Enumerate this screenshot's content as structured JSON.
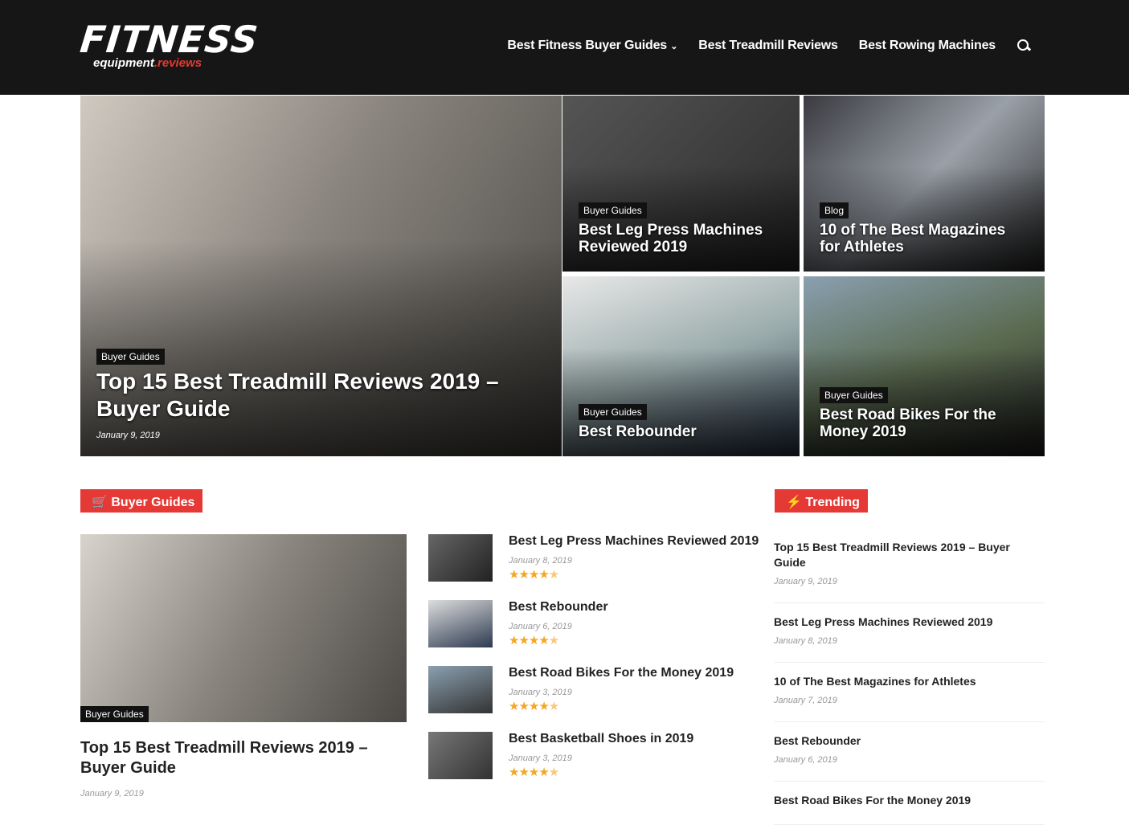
{
  "header": {
    "logo_main": "FITNESS",
    "logo_sub_a": "equipment",
    "logo_sub_b": ".reviews",
    "nav": [
      {
        "label": "Best Fitness Buyer Guides",
        "chevron": true
      },
      {
        "label": "Best Treadmill Reviews"
      },
      {
        "label": "Best Rowing Machines"
      }
    ],
    "search_icon": "search-icon"
  },
  "hero": [
    {
      "category": "Buyer Guides",
      "title": "Top 15 Best Treadmill Reviews 2019 – Buyer Guide",
      "date": "January 9, 2019"
    },
    {
      "category": "Buyer Guides",
      "title": "Best Leg Press Machines Reviewed 2019"
    },
    {
      "category": "Blog",
      "title": "10 of The Best Magazines for Athletes"
    },
    {
      "category": "Buyer Guides",
      "title": "Best Rebounder"
    },
    {
      "category": "Buyer Guides",
      "title": "Best Road Bikes For the Money 2019"
    }
  ],
  "buyer_guides": {
    "label": "Buyer Guides",
    "icon": "cart-icon",
    "featured": {
      "category": "Buyer Guides",
      "title": "Top 15 Best Treadmill Reviews 2019 – Buyer Guide",
      "date": "January 9, 2019"
    },
    "items": [
      {
        "title": "Best Leg Press Machines Reviewed 2019",
        "date": "January 8, 2019",
        "rating": 4.8
      },
      {
        "title": "Best Rebounder",
        "date": "January 6, 2019",
        "rating": 4.6
      },
      {
        "title": "Best Road Bikes For the Money 2019",
        "date": "January 3, 2019",
        "rating": 4.7
      },
      {
        "title": "Best Basketball Shoes in 2019",
        "date": "January 3, 2019",
        "rating": 4.7
      }
    ]
  },
  "trending": {
    "label": "Trending",
    "icon": "bolt-icon",
    "items": [
      {
        "title": "Top 15 Best Treadmill Reviews 2019 – Buyer Guide",
        "date": "January 9, 2019"
      },
      {
        "title": "Best Leg Press Machines Reviewed 2019",
        "date": "January 8, 2019"
      },
      {
        "title": "10 of The Best Magazines for Athletes",
        "date": "January 7, 2019"
      },
      {
        "title": "Best Rebounder",
        "date": "January 6, 2019"
      },
      {
        "title": "Best Road Bikes For the Money 2019"
      }
    ]
  },
  "colors": {
    "accent": "#e53935",
    "header_bg": "#161616",
    "stars": "#f5a623"
  }
}
